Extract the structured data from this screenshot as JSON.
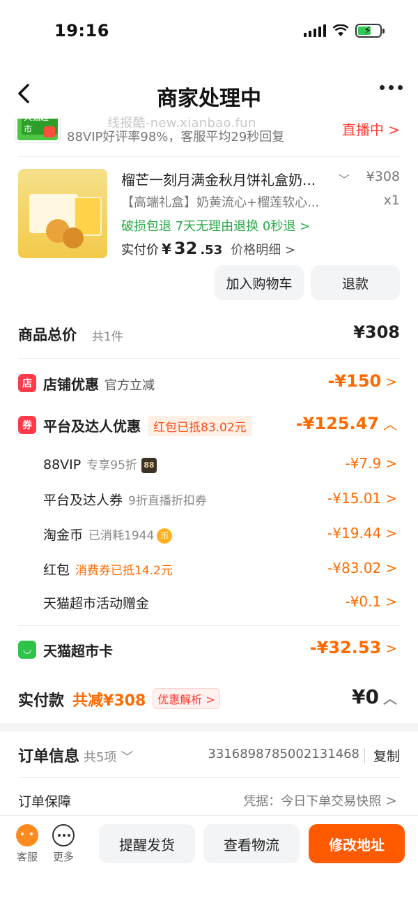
{
  "status": {
    "time": "19:16"
  },
  "nav": {
    "title": "商家处理中"
  },
  "watermark": "线报酷-new.xianbao.fun",
  "store": {
    "logo_text": "天猫超市",
    "desc": "88VIP好评率98%，客服平均29秒回复",
    "live_label": "直播中 >"
  },
  "product": {
    "title": "榴芒一刻月满金秋月饼礼盒奶...",
    "price": "¥308",
    "sku": "【高端礼盒】奶黄流心+榴莲软心...",
    "qty": "x1",
    "services": "破损包退  7天无理由退换  0秒退 >",
    "paid_label": "实付价",
    "paid_yen": "¥",
    "paid_int": "32",
    "paid_dec": ".53",
    "detail_label": "价格明细 >",
    "btn_cart": "加入购物车",
    "btn_refund": "退款"
  },
  "total": {
    "label": "商品总价",
    "count": "共1件",
    "amount": "¥308"
  },
  "shop_discount": {
    "icon": "店",
    "label": "店铺优惠",
    "sub": "官方立减",
    "amount": "-¥150"
  },
  "platform_discount": {
    "icon": "券",
    "label": "平台及达人优惠",
    "badge": "红包已抵83.02元",
    "amount": "-¥125.47",
    "items": [
      {
        "label": "88VIP",
        "note": "专享95折",
        "amount": "-¥7.9"
      },
      {
        "label": "平台及达人券",
        "note": "9折直播折扣券",
        "amount": "-¥15.01"
      },
      {
        "label": "淘金币",
        "note": "已消耗1944",
        "amount": "-¥19.44"
      },
      {
        "label": "红包",
        "note": "消费券已抵14.2元",
        "amount": "-¥83.02"
      },
      {
        "label": "天猫超市活动赠金",
        "note": "",
        "amount": "-¥0.1"
      }
    ]
  },
  "tmall_card": {
    "label": "天猫超市卡",
    "amount": "-¥32.53"
  },
  "pay": {
    "label": "实付款",
    "save": "共减¥308",
    "chip": "优惠解析 >",
    "amount": "¥0"
  },
  "order": {
    "title": "订单信息",
    "count": "共5项",
    "number": "3316898785002131468",
    "copy": "复制"
  },
  "guarantee": {
    "label": "订单保障",
    "value": "凭据：今日下单交易快照"
  },
  "bottom": {
    "service_label": "客服",
    "more_label": "更多",
    "btn_remind": "提醒发货",
    "btn_logistics": "查看物流",
    "btn_address": "修改地址"
  },
  "colors": {
    "accent": "#ff6a00",
    "green": "#27a846",
    "red": "#ff3b30"
  }
}
